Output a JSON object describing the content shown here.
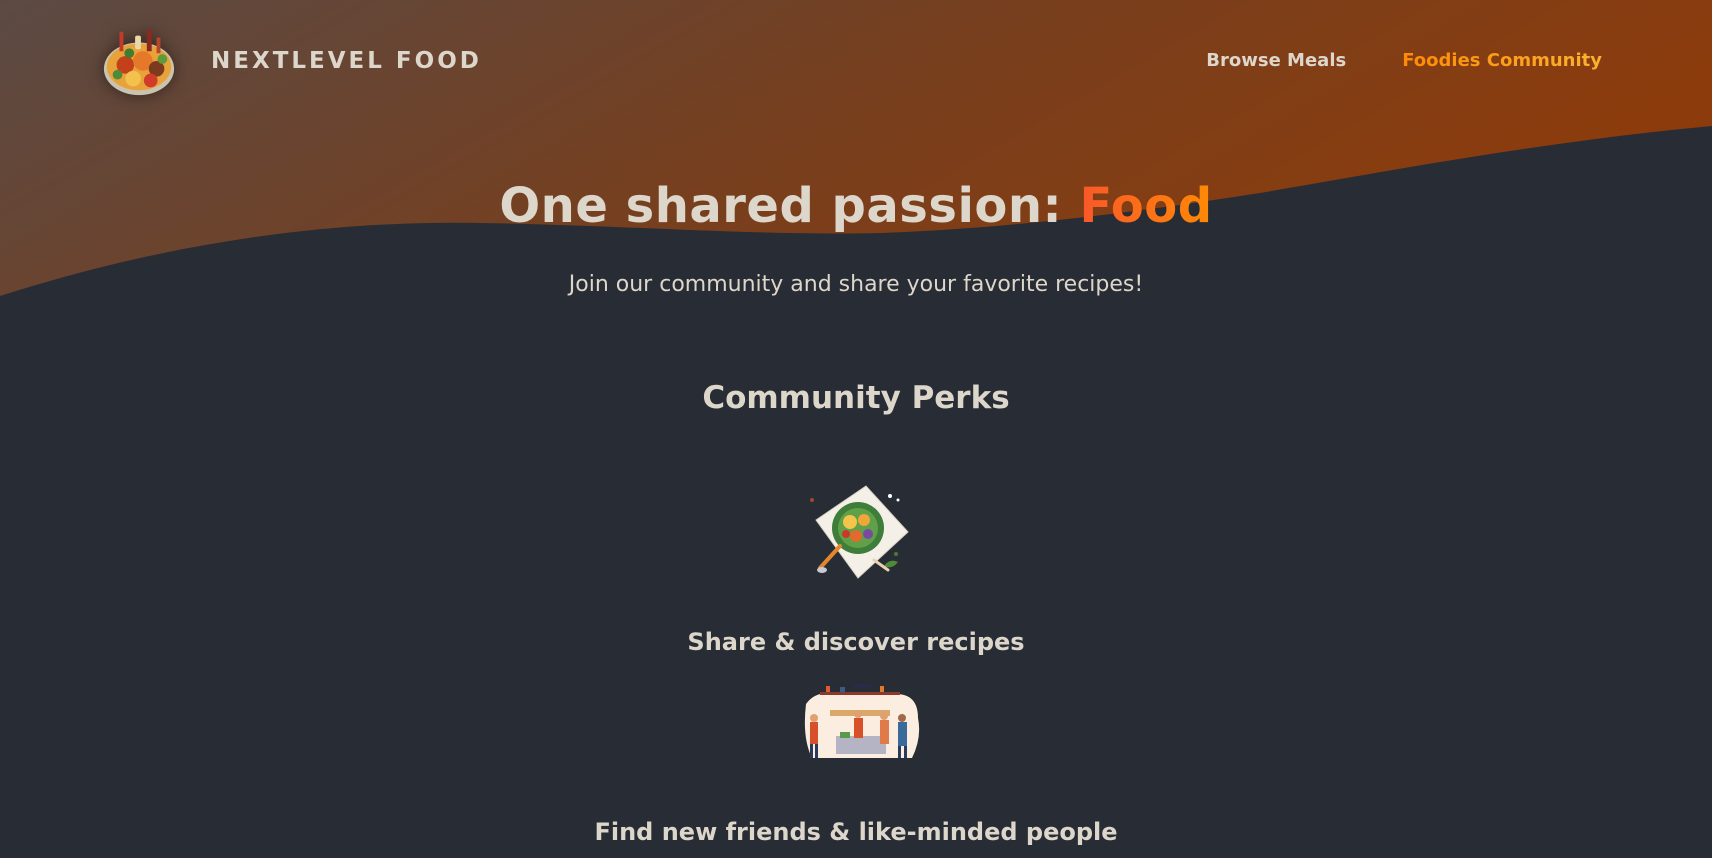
{
  "brand": {
    "name": "NEXTLEVEL FOOD",
    "logo_icon": "food-platter-logo-icon"
  },
  "nav": {
    "items": [
      {
        "label": "Browse Meals",
        "active": false
      },
      {
        "label": "Foodies Community",
        "active": true
      }
    ]
  },
  "hero": {
    "title_prefix": "One shared passion: ",
    "title_highlight": "Food",
    "subtitle": "Join our community and share your favorite recipes!"
  },
  "perks": {
    "heading": "Community Perks",
    "items": [
      {
        "label": "Share & discover recipes",
        "icon": "meal-plate-illustration"
      },
      {
        "label": "Find new friends & like-minded people",
        "icon": "community-kitchen-illustration"
      }
    ]
  },
  "colors": {
    "background": "#282c34",
    "header_gradient_start": "#5b4a44",
    "header_gradient_end": "#8a3d0f",
    "text": "#ddd6cb",
    "accent_orange": "#ff8a05",
    "accent_red": "#f9572a",
    "active_nav": "#f9b241"
  }
}
